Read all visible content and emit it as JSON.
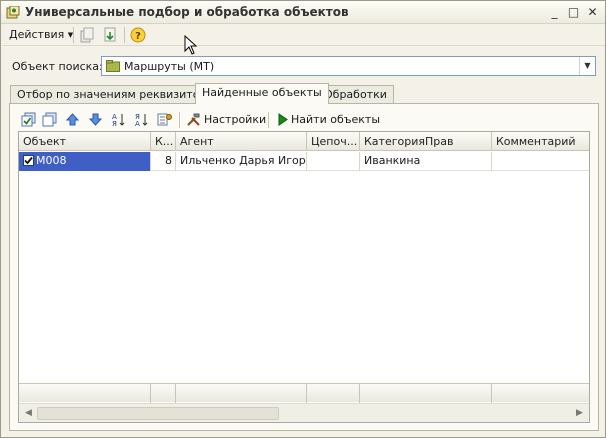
{
  "window": {
    "title": "Универсальные подбор и обработка объектов",
    "controls": {
      "minimize": "_",
      "maximize": "□",
      "close": "✕"
    }
  },
  "toolbar": {
    "actions_label": "Действия",
    "icons": [
      "copy-doc-icon",
      "download-doc-icon",
      "help-icon"
    ]
  },
  "search": {
    "label": "Объект поиска:",
    "value": "Маршруты (МТ)"
  },
  "tabs": [
    {
      "label": "Отбор по значениям реквизитов",
      "active": false
    },
    {
      "label": "Найденные объекты",
      "active": true
    },
    {
      "label": "Обработки",
      "active": false
    }
  ],
  "inner_toolbar": {
    "settings_label": "Настройки",
    "find_label": "Найти объекты"
  },
  "table": {
    "columns": [
      "Объект",
      "К...",
      "Агент",
      "Цепоч...",
      "КатегорияПрав",
      "Комментарий"
    ],
    "rows": [
      {
        "object": "M008",
        "checked": true,
        "k": "8",
        "agent": "Ильченко Дарья Игор...",
        "chain": "",
        "category": "Иванкина",
        "comment": ""
      }
    ]
  },
  "colors": {
    "selection": "#3f5fc4",
    "accent_green": "#1a8a1a"
  }
}
